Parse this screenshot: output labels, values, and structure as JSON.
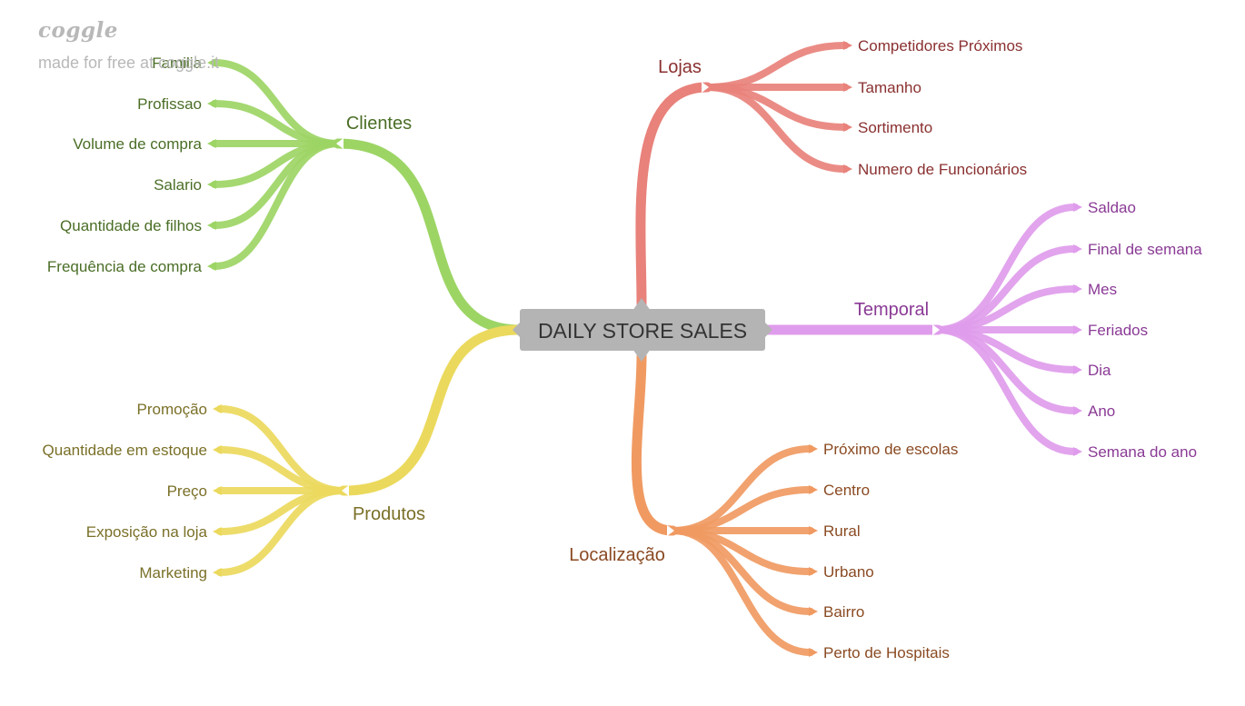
{
  "watermark": {
    "logo": "coggle",
    "text": "made for free at coggle.it"
  },
  "center": {
    "label": "DAILY STORE SALES",
    "color": "#b4b4b4"
  },
  "branches": [
    {
      "label": "Lojas",
      "color": "#e8827b",
      "text_color": "#8a3030",
      "children": [
        "Competidores Próximos",
        "Tamanho",
        "Sortimento",
        "Numero de Funcionários"
      ]
    },
    {
      "label": "Temporal",
      "color": "#e09cec",
      "text_color": "#8a3a95",
      "children": [
        "Saldao",
        "Final de semana",
        "Mes",
        "Feriados",
        "Dia",
        "Ano",
        "Semana do ano"
      ]
    },
    {
      "label": "Localização",
      "color": "#f09a62",
      "text_color": "#8a4a22",
      "children": [
        "Próximo de escolas",
        "Centro",
        "Rural",
        "Urbano",
        "Bairro",
        "Perto de Hospitais"
      ]
    },
    {
      "label": "Clientes",
      "color": "#9dd565",
      "text_color": "#4a6e26",
      "children": [
        "Familia",
        "Profissao",
        "Volume de compra",
        "Salario",
        "Quantidade de filhos",
        "Frequência de compra"
      ]
    },
    {
      "label": "Produtos",
      "color": "#ebd95d",
      "text_color": "#7a7028",
      "children": [
        "Promoção",
        "Quantidade em estoque",
        "Preço",
        "Exposição na loja",
        "Marketing"
      ]
    }
  ]
}
